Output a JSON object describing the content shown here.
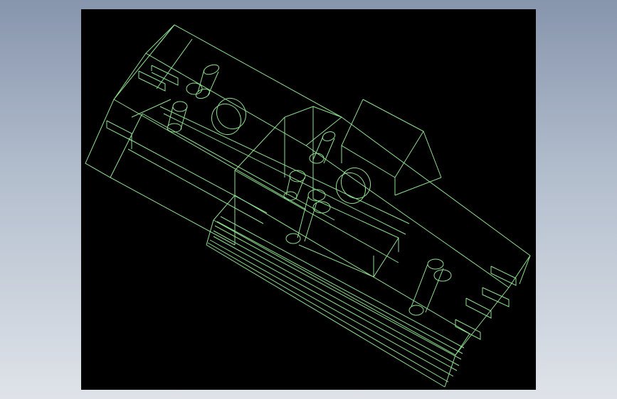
{
  "viewport": {
    "background": "#000000",
    "wire_color": "#8fe08f",
    "render_style": "wireframe",
    "content": "cad-assembly"
  },
  "app": {
    "background_top": "#8795ad",
    "background_bottom": "#dfe3e9"
  }
}
